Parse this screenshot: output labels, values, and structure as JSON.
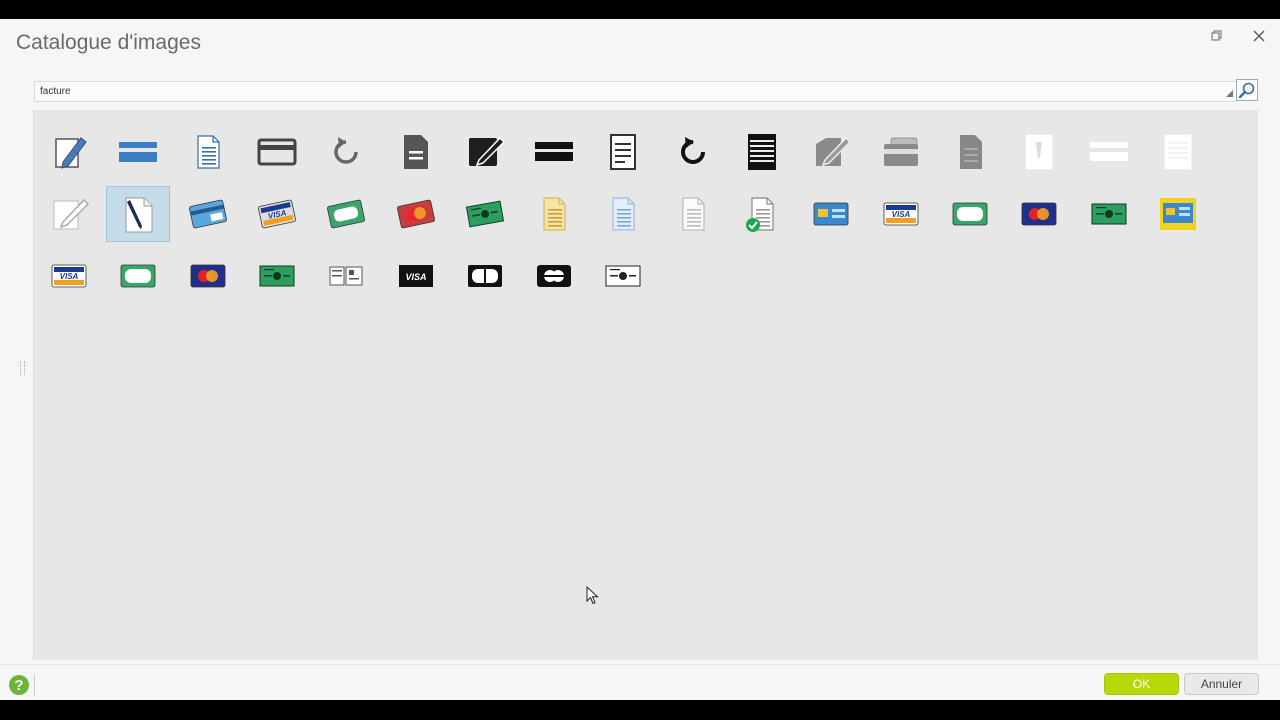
{
  "dialog": {
    "title": "Catalogue d'images"
  },
  "search": {
    "value": "facture"
  },
  "grid": {
    "rows": [
      [
        "pencil-edit-doc-icon",
        "blue-bar-icon",
        "document-lines-icon",
        "credit-card-outline-icon",
        "refresh-grey-icon",
        "document-filled-icon",
        "edit-box-dark-icon",
        "black-bar-icon",
        "document-outline-lines-icon",
        "refresh-black-icon",
        "lines-list-icon",
        "edit-grey-icon",
        "cards-stack-grey-icon",
        "document-grey-icon",
        "doc-white-icon",
        "white-bar-icon",
        "doc-lines-white-icon"
      ],
      [
        "edit-white-icon",
        "pen-document-icon",
        "blue-card-icon",
        "visa-card-3d-icon",
        "green-card-icon",
        "mastercard-3d-icon",
        "cheque-green-3d-icon",
        "yellow-document-icon",
        "blue-document-icon",
        "white-document-icon",
        "document-check-icon",
        "blue-card-flat-icon",
        "visa-card-icon",
        "green-pill-card-icon",
        "mastercard-icon",
        "cheque-green-icon",
        "yellow-card-icon"
      ],
      [
        "visa-card-icon",
        "green-pill-card-icon",
        "mastercard-icon",
        "cheque-green-icon",
        "small-cards-icon",
        "visa-black-card-icon",
        "pill-black-card-icon",
        "round-black-card-icon",
        "cheque-white-icon"
      ]
    ],
    "selected": "pen-document-icon"
  },
  "footer": {
    "help": "?",
    "ok_label": "OK",
    "cancel_label": "Annuler"
  },
  "colors": {
    "accent": "#b8d80a",
    "selection": "#c3dce8",
    "panel": "#e7e7e7"
  }
}
